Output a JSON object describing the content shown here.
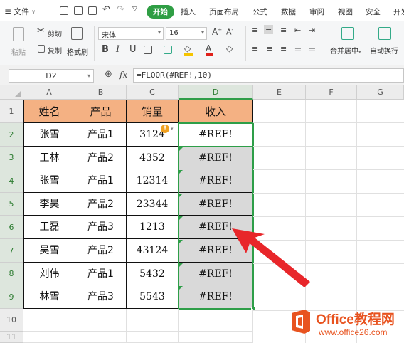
{
  "menu": {
    "file": "文件",
    "tabs": [
      "开始",
      "插入",
      "页面布局",
      "公式",
      "数据",
      "审阅",
      "视图",
      "安全",
      "开发"
    ]
  },
  "ribbon": {
    "paste": "粘贴",
    "cut": "剪切",
    "copy": "复制",
    "format_painter": "格式刷",
    "font_name": "宋体",
    "font_size": "16",
    "merge_center": "合并居中",
    "wrap_text": "自动换行"
  },
  "formula_bar": {
    "name_box": "D2",
    "fx": "fx",
    "formula": "=FLOOR(#REF!,10)"
  },
  "sheet": {
    "columns": [
      "A",
      "B",
      "C",
      "D",
      "E",
      "F",
      "G"
    ],
    "rows": [
      "1",
      "2",
      "3",
      "4",
      "5",
      "6",
      "7",
      "8",
      "9",
      "10",
      "11"
    ],
    "headers": [
      "姓名",
      "产品",
      "销量",
      "收入"
    ],
    "data": [
      [
        "张雪",
        "产品1",
        "3124",
        "#REF!"
      ],
      [
        "王林",
        "产品2",
        "4352",
        "#REF!"
      ],
      [
        "张雪",
        "产品1",
        "12314",
        "#REF!"
      ],
      [
        "李昊",
        "产品2",
        "23344",
        "#REF!"
      ],
      [
        "王磊",
        "产品3",
        "1213",
        "#REF!"
      ],
      [
        "吴雪",
        "产品2",
        "43124",
        "#REF!"
      ],
      [
        "刘伟",
        "产品1",
        "5432",
        "#REF!"
      ],
      [
        "林雪",
        "产品3",
        "5543",
        "#REF!"
      ]
    ],
    "warning_icon": "!"
  },
  "watermark": {
    "title": "Office教程网",
    "url": "www.office26.com"
  },
  "colors": {
    "accent_green": "#2e9e48",
    "header_fill": "#f4b183",
    "selection_fill": "#d9d9d9",
    "arrow_red": "#e8262a",
    "watermark_orange": "#e8531f"
  }
}
